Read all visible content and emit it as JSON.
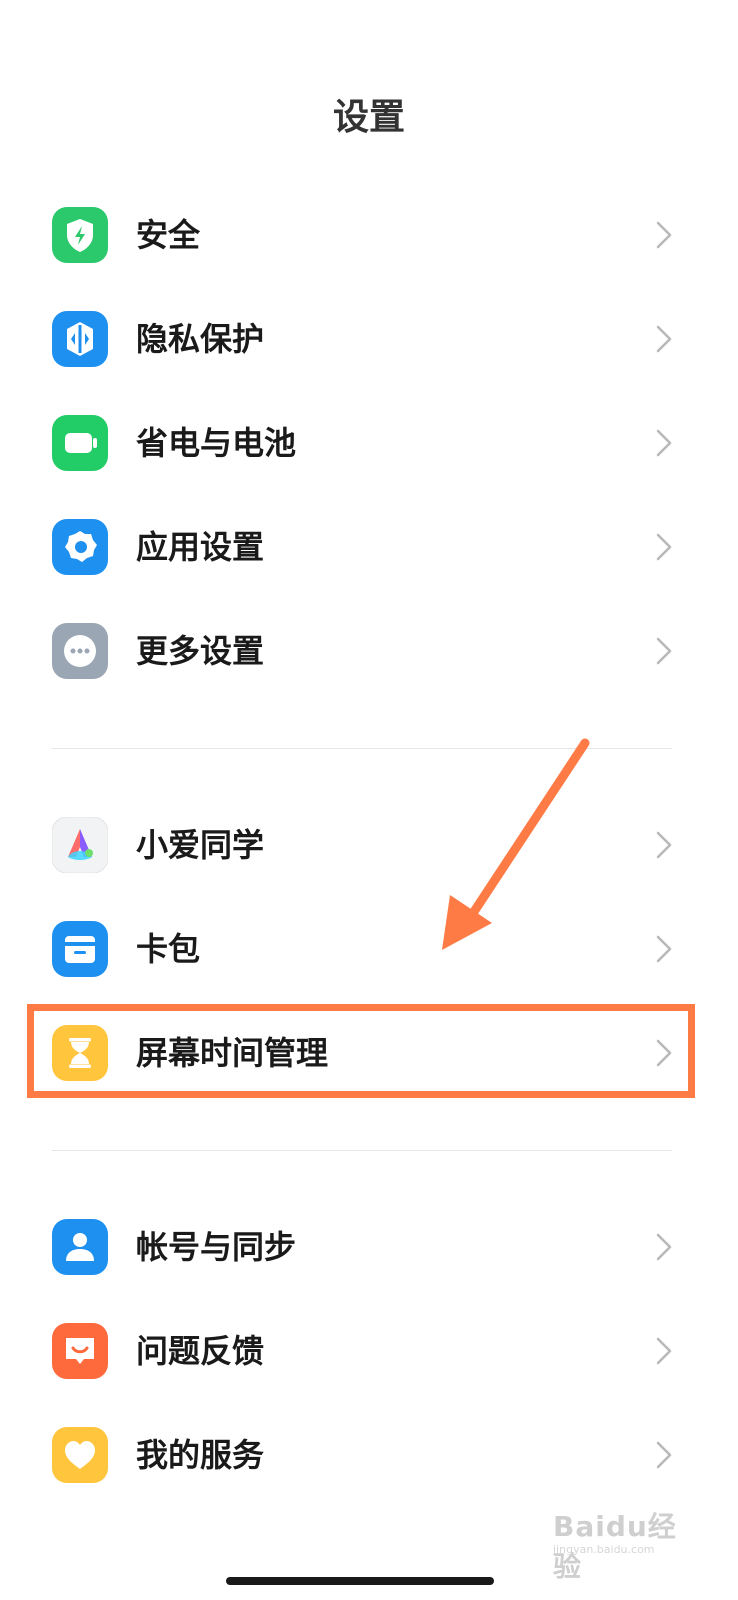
{
  "header": {
    "title": "设置"
  },
  "groups": [
    {
      "items": [
        {
          "label": "安全",
          "icon": "shield-icon",
          "color": "#2bc96b"
        },
        {
          "label": "隐私保护",
          "icon": "privacy-icon",
          "color": "#1e90f0"
        },
        {
          "label": "省电与电池",
          "icon": "battery-icon",
          "color": "#22cc66"
        },
        {
          "label": "应用设置",
          "icon": "gear-icon",
          "color": "#1e90f0"
        },
        {
          "label": "更多设置",
          "icon": "more-icon",
          "color": "#9aa6b4"
        }
      ]
    },
    {
      "items": [
        {
          "label": "小爱同学",
          "icon": "xiaoai-icon",
          "color": "#f2f3f5"
        },
        {
          "label": "卡包",
          "icon": "wallet-icon",
          "color": "#1e90f0"
        },
        {
          "label": "屏幕时间管理",
          "icon": "hourglass-icon",
          "color": "#ffc53d"
        }
      ]
    },
    {
      "items": [
        {
          "label": "帐号与同步",
          "icon": "account-icon",
          "color": "#1e90f0"
        },
        {
          "label": "问题反馈",
          "icon": "feedback-icon",
          "color": "#ff6a3d"
        },
        {
          "label": "我的服务",
          "icon": "heart-icon",
          "color": "#ffc53d"
        }
      ]
    }
  ],
  "annotation": {
    "highlight_color": "#ff7b45"
  },
  "watermark": {
    "brand": "Baidu经验",
    "url": "jingyan.baidu.com"
  }
}
